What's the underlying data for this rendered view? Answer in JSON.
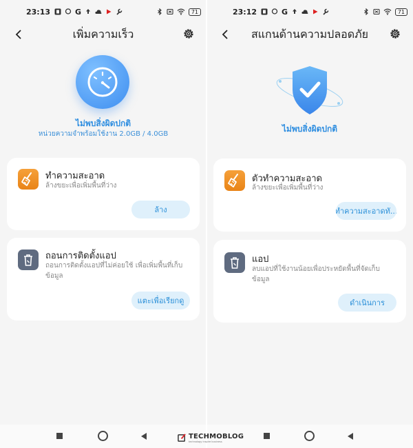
{
  "left": {
    "status_time": "23:13",
    "battery": "71",
    "title": "เพิ่มความเร็ว",
    "hero_status": "ไม่พบสิ่งผิดปกติ",
    "hero_sub": "หน่วยความจำพร้อมใช้งาน 2.0GB / 4.0GB",
    "cards": [
      {
        "title": "ทำความสะอาด",
        "desc": "ล้างขยะเพื่อเพิ่มพื้นที่ว่าง",
        "button": "ล้าง"
      },
      {
        "title": "ถอนการติดตั้งแอป",
        "desc": "ถอนการติดตั้งแอปที่ไม่ค่อยใช้ เพื่อเพิ่มพื้นที่เก็บข้อมูล",
        "button": "แตะเพื่อเรียกดู"
      }
    ]
  },
  "right": {
    "status_time": "23:12",
    "battery": "71",
    "title": "สแกนด้านความปลอดภัย",
    "hero_status": "ไม่พบสิ่งผิดปกติ",
    "cards": [
      {
        "title": "ตัวทำความสะอาด",
        "desc": "ล้างขยะเพื่อเพิ่มพื้นที่ว่าง",
        "button": "ทำความสะอาดทั..."
      },
      {
        "title": "แอป",
        "desc": "ลบแอปที่ใช้งานน้อยเพื่อประหยัดพื้นที่จัดเก็บข้อมูล",
        "button": "ดำเนินการ"
      }
    ]
  },
  "watermark": {
    "name": "TECHMOBLOG",
    "tagline": "technology inspire business"
  },
  "colors": {
    "accent": "#2a8fd8",
    "pill_bg": "#dff0fb",
    "orange_icon": "#e98417",
    "slate_icon": "#5f6b80"
  },
  "icons": {
    "back": "chevron-left-icon",
    "settings": "gear-icon",
    "clean": "broom-icon",
    "uninstall": "trash-icon"
  }
}
